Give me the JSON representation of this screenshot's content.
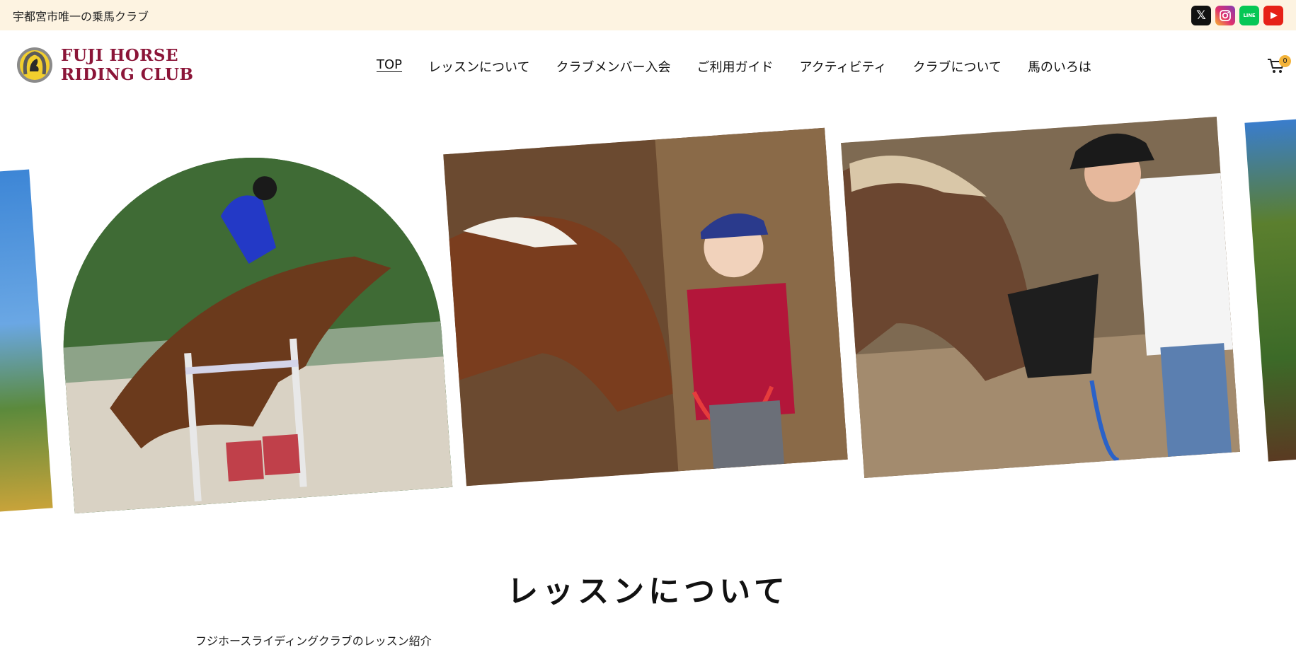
{
  "topbar": {
    "tagline": "宇都宮市唯一の乗馬クラブ",
    "social": [
      {
        "name": "x-icon",
        "glyph": "𝕏"
      },
      {
        "name": "instagram-icon",
        "glyph": "◎"
      },
      {
        "name": "line-icon",
        "glyph": "LINE"
      },
      {
        "name": "youtube-icon",
        "glyph": "▶"
      }
    ]
  },
  "header": {
    "logo_line1": "FUJI HORSE",
    "logo_line2": "RIDING CLUB",
    "nav": [
      {
        "label": "TOP",
        "active": true
      },
      {
        "label": "レッスンについて",
        "active": false
      },
      {
        "label": "クラブメンバー入会",
        "active": false
      },
      {
        "label": "ご利用ガイド",
        "active": false
      },
      {
        "label": "アクティビティ",
        "active": false
      },
      {
        "label": "クラブについて",
        "active": false
      },
      {
        "label": "馬のいろは",
        "active": false
      }
    ],
    "cart_count": "0"
  },
  "section": {
    "title": "レッスンについて",
    "subtitle": "フジホースライディングクラブのレッスン紹介"
  },
  "colors": {
    "topbar_bg": "#fdf3e1",
    "brand": "#8b1538",
    "badge": "#f4b43a"
  }
}
